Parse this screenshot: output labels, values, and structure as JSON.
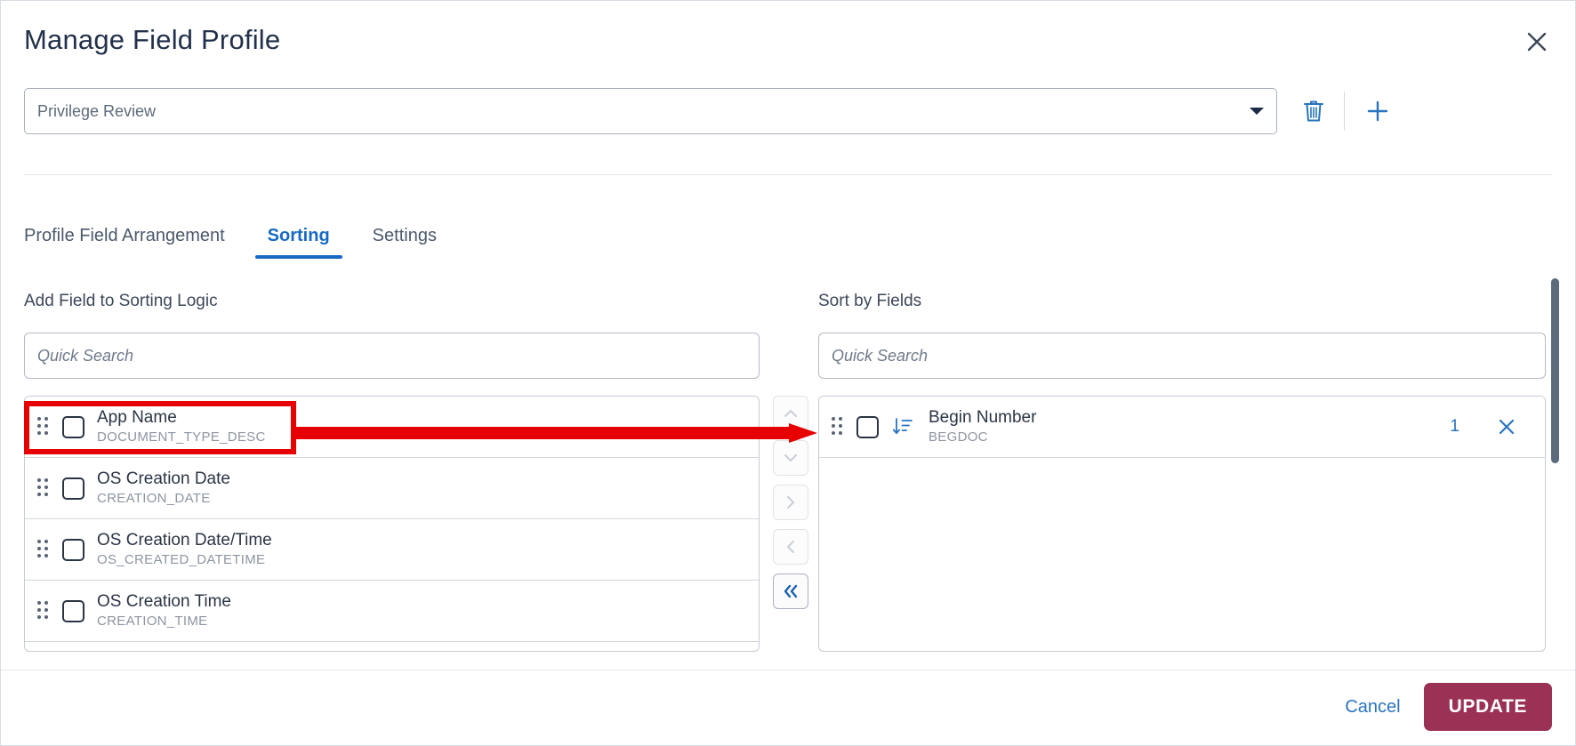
{
  "dialog": {
    "title": "Manage Field Profile",
    "close_icon": "close-icon"
  },
  "profile": {
    "selected": "Privilege Review",
    "dropdown_icon": "chevron-down-icon",
    "delete_icon": "trash-icon",
    "add_icon": "plus-icon"
  },
  "tabs": [
    {
      "label": "Profile Field Arrangement",
      "active": false
    },
    {
      "label": "Sorting",
      "active": true
    },
    {
      "label": "Settings",
      "active": false
    }
  ],
  "left_panel": {
    "label": "Add Field to Sorting Logic",
    "search_placeholder": "Quick Search",
    "search_value": "",
    "items": [
      {
        "name": "App Name",
        "code": "DOCUMENT_TYPE_DESC",
        "checked": false,
        "highlighted": true
      },
      {
        "name": "OS Creation Date",
        "code": "CREATION_DATE",
        "checked": false,
        "highlighted": false
      },
      {
        "name": "OS Creation Date/Time",
        "code": "OS_CREATED_DATETIME",
        "checked": false,
        "highlighted": false
      },
      {
        "name": "OS Creation Time",
        "code": "CREATION_TIME",
        "checked": false,
        "highlighted": false
      }
    ]
  },
  "right_panel": {
    "label": "Sort by Fields",
    "search_placeholder": "Quick Search",
    "search_value": "",
    "items": [
      {
        "name": "Begin Number",
        "code": "BEGDOC",
        "checked": false,
        "sort_direction_icon": "sort-ascending-icon",
        "order": "1",
        "remove_icon": "close-icon"
      }
    ]
  },
  "transfer_buttons": [
    {
      "icon": "chevron-up-icon",
      "enabled": false
    },
    {
      "icon": "chevron-down-icon",
      "enabled": false
    },
    {
      "icon": "chevron-right-icon",
      "enabled": false
    },
    {
      "icon": "chevron-left-icon",
      "enabled": false
    },
    {
      "icon": "chevron-double-left-icon",
      "enabled": true
    }
  ],
  "footer": {
    "cancel_label": "Cancel",
    "update_label": "UPDATE"
  },
  "colors": {
    "accent_blue": "#1769c4",
    "link_blue": "#2874c0",
    "update_maroon": "#9b3255",
    "annotation_red": "#e60000",
    "title_navy": "#22304a",
    "muted_grey": "#8d95a1"
  }
}
